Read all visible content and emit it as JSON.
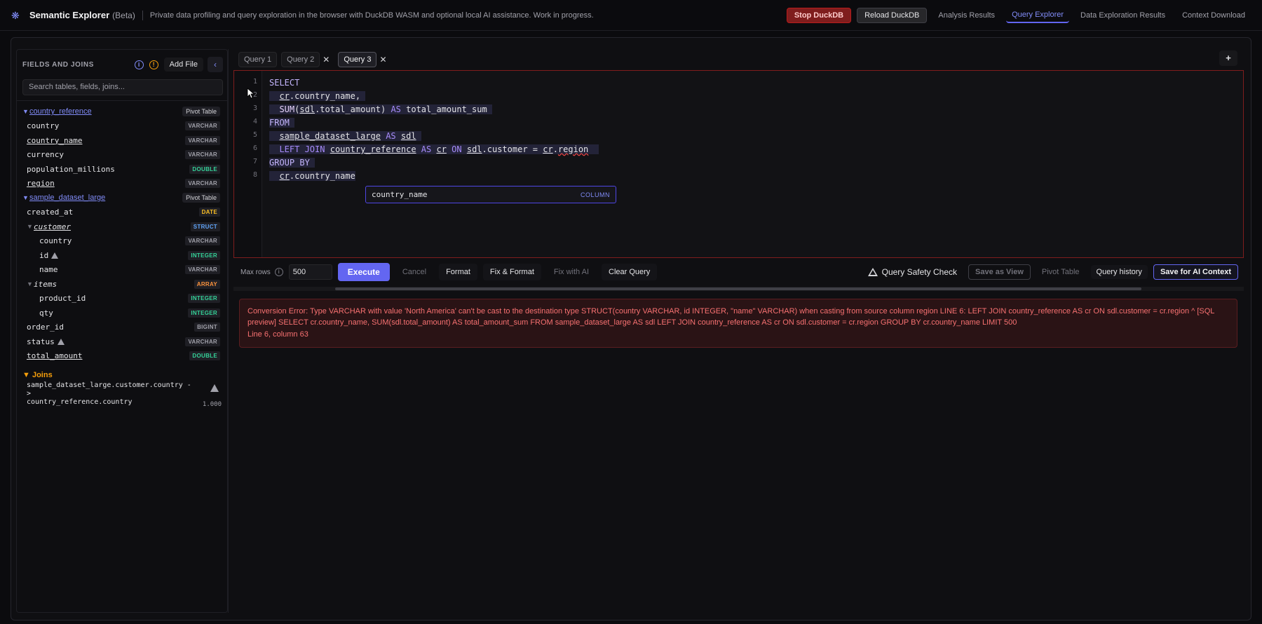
{
  "header": {
    "title": "Semantic Explorer",
    "beta": "(Beta)",
    "subtitle": "Private data profiling and query exploration in the browser with DuckDB WASM and optional local AI assistance. Work in progress.",
    "stop_label": "Stop DuckDB",
    "reload_label": "Reload DuckDB",
    "nav": [
      "Analysis Results",
      "Query Explorer",
      "Data Exploration Results",
      "Context Download"
    ],
    "active_nav": "Query Explorer"
  },
  "sidebar": {
    "title": "FIELDS AND JOINS",
    "add_file": "Add File",
    "search_placeholder": "Search tables, fields, joins...",
    "tables": [
      {
        "name": "country_reference",
        "action": "Pivot Table",
        "fields": [
          {
            "name": "country",
            "type": "VARCHAR"
          },
          {
            "name": "country_name",
            "type": "VARCHAR"
          },
          {
            "name": "currency",
            "type": "VARCHAR"
          },
          {
            "name": "population_millions",
            "type": "DOUBLE"
          },
          {
            "name": "region",
            "type": "VARCHAR"
          }
        ]
      },
      {
        "name": "sample_dataset_large",
        "action": "Pivot Table",
        "fields": [
          {
            "name": "created_at",
            "type": "DATE"
          },
          {
            "name": "customer",
            "type": "STRUCT"
          },
          {
            "name": "country",
            "type": "VARCHAR"
          },
          {
            "name": "id",
            "type": "INTEGER"
          },
          {
            "name": "name",
            "type": "VARCHAR"
          },
          {
            "name": "items",
            "type": "ARRAY"
          },
          {
            "name": "product_id",
            "type": "INTEGER"
          },
          {
            "name": "qty",
            "type": "INTEGER"
          },
          {
            "name": "order_id",
            "type": "BIGINT"
          },
          {
            "name": "status",
            "type": "VARCHAR"
          },
          {
            "name": "total_amount",
            "type": "DOUBLE"
          }
        ]
      }
    ],
    "joins_title": "Joins",
    "joins": [
      {
        "line1": "sample_dataset_large.customer.country ->",
        "line2": "country_reference.country",
        "confidence": "1.000"
      }
    ]
  },
  "tabs": [
    "Query 1",
    "Query 2",
    "Query 3"
  ],
  "active_tab": "Query 3",
  "editor": {
    "line_numbers": [
      "1",
      "2",
      "3",
      "4",
      "5",
      "6",
      "7",
      "8"
    ],
    "autocomplete": {
      "text": "country_name",
      "kind": "COLUMN"
    }
  },
  "toolbar": {
    "max_rows_label": "Max rows",
    "max_rows_value": "500",
    "execute": "Execute",
    "cancel": "Cancel",
    "format": "Format",
    "fix_format": "Fix & Format",
    "fix_ai": "Fix with AI",
    "clear": "Clear Query",
    "safety": "Query Safety Check",
    "save_view": "Save as View",
    "pivot": "Pivot Table",
    "history": "Query history",
    "save_ai": "Save for AI Context"
  },
  "error": {
    "message": "Conversion Error: Type VARCHAR with value 'North America' can't be cast to the destination type STRUCT(country VARCHAR, id INTEGER, \"name\" VARCHAR) when casting from source column region LINE 6: LEFT JOIN country_reference AS cr ON sdl.customer = cr.region ^ [SQL preview] SELECT cr.country_name, SUM(sdl.total_amount) AS total_amount_sum FROM sample_dataset_large AS sdl LEFT JOIN country_reference AS cr ON sdl.customer = cr.region GROUP BY cr.country_name LIMIT 500",
    "location": "Line 6, column 63"
  },
  "colors": {
    "accent": "#6366f1",
    "error": "#f87171",
    "stop": "#b91c1c"
  }
}
